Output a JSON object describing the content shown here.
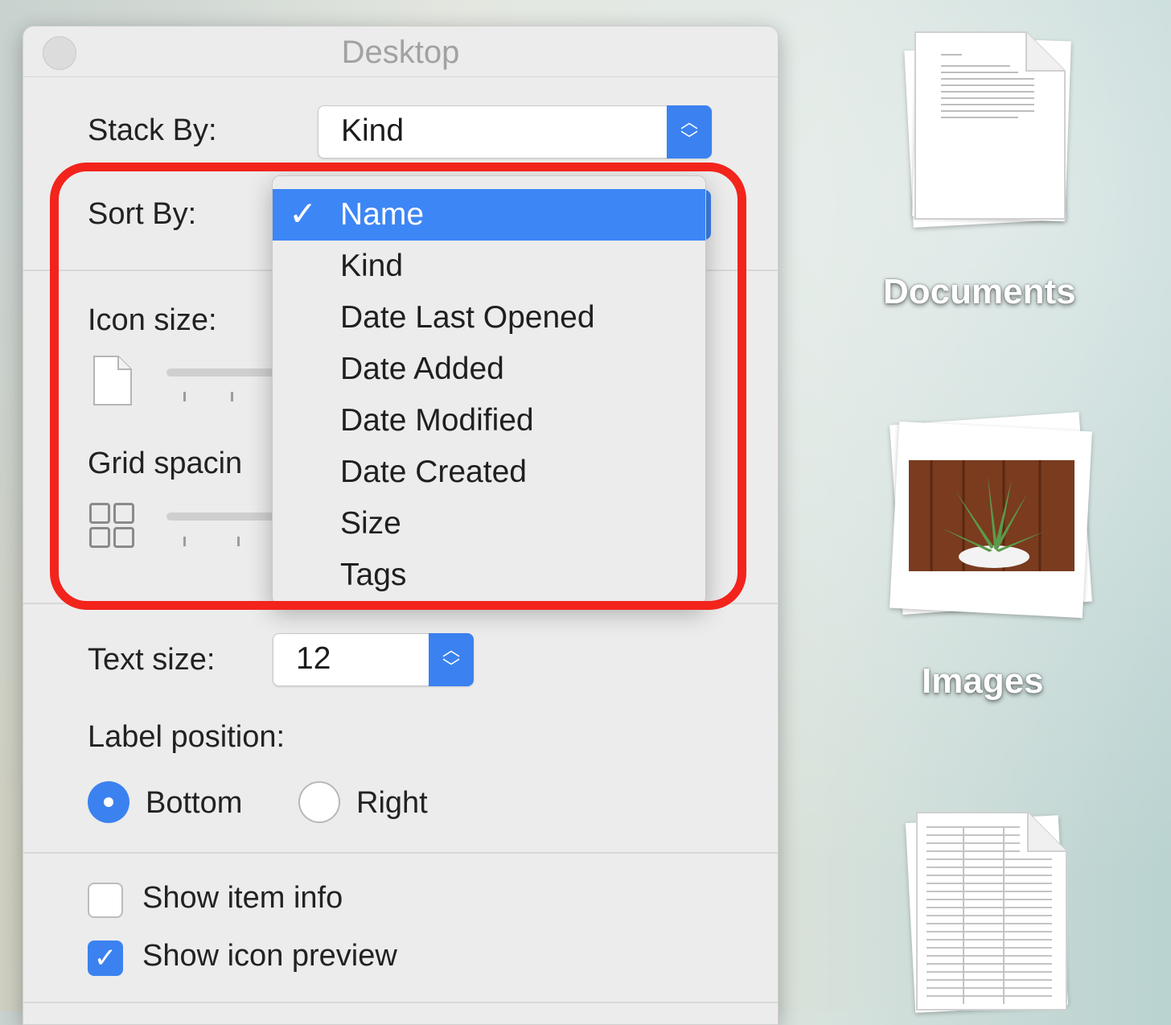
{
  "window": {
    "title": "Desktop"
  },
  "stack_by": {
    "label": "Stack By:",
    "value": "Kind"
  },
  "sort_by": {
    "label": "Sort By:",
    "options": [
      "Name",
      "Kind",
      "Date Last Opened",
      "Date Added",
      "Date Modified",
      "Date Created",
      "Size",
      "Tags"
    ],
    "selected": "Name",
    "checkmark": "✓"
  },
  "icon_size": {
    "label": "Icon size:"
  },
  "grid_spacing": {
    "label": "Grid spacin"
  },
  "text_size": {
    "label": "Text size:",
    "value": "12"
  },
  "label_position": {
    "label": "Label position:",
    "options": [
      {
        "label": "Bottom",
        "selected": true
      },
      {
        "label": "Right",
        "selected": false
      }
    ]
  },
  "checkboxes": [
    {
      "label": "Show item info",
      "checked": false
    },
    {
      "label": "Show icon preview",
      "checked": true
    }
  ],
  "desktop_icons": [
    {
      "label": "Documents"
    },
    {
      "label": "Images"
    },
    {
      "label": ""
    }
  ],
  "colors": {
    "accent": "#3b82f0",
    "highlight": "#f2241c",
    "panel": "#ececec"
  }
}
